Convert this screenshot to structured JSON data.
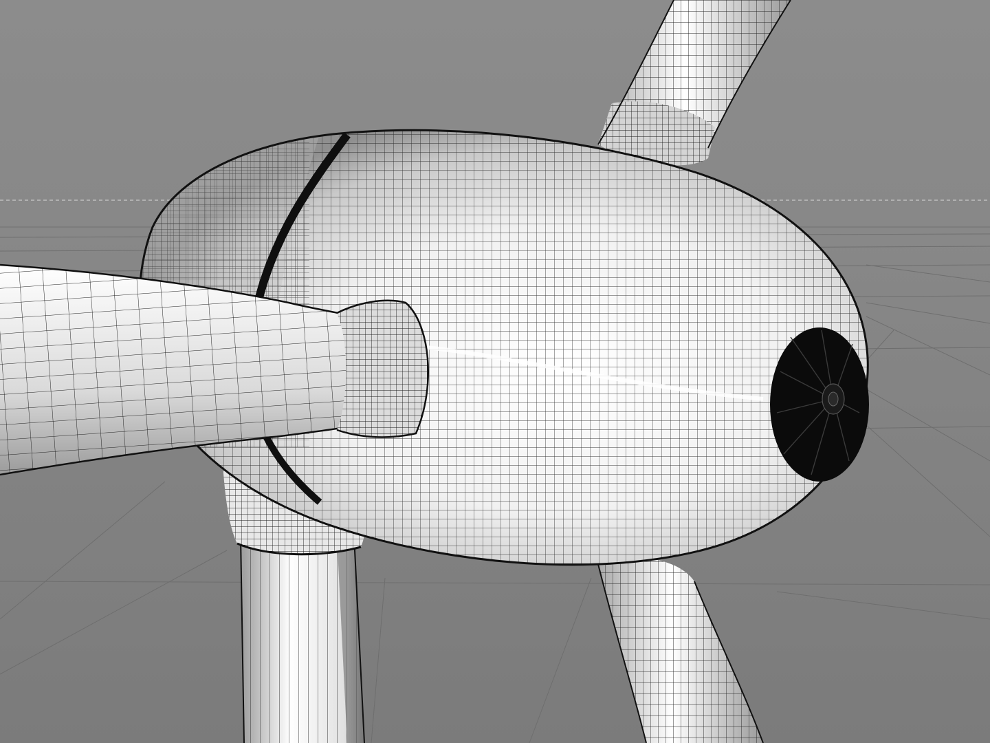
{
  "viewport": {
    "colors": {
      "background_top": "#8a8a8a",
      "background_bottom": "#7a7a7a",
      "floor": "#858585",
      "grid_line": "#6f6f6f",
      "horizon_guide": "#c8c8c8",
      "surface_light": "#ffffff",
      "surface_mid": "#d6d6d6",
      "surface_dark": "#8e8e8e",
      "wire": "#1b1b1b",
      "seam": "#111111",
      "nose_cap": "#0a0a0a"
    },
    "objects": [
      "nacelle",
      "spinner-nose",
      "blade-left",
      "blade-top",
      "blade-bottom",
      "yaw-bearing",
      "tower"
    ]
  }
}
